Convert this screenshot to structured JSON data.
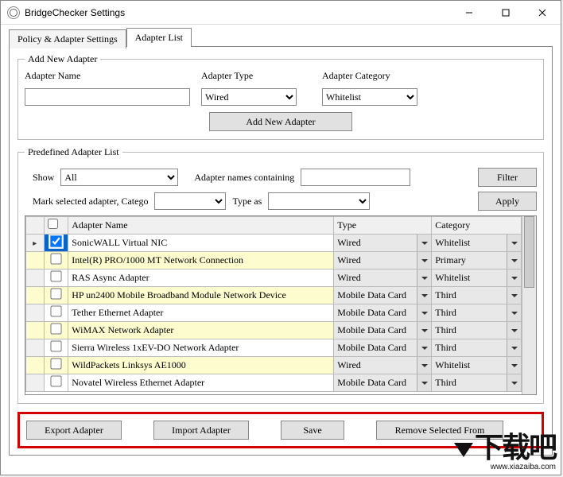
{
  "window": {
    "title": "BridgeChecker Settings"
  },
  "tabs": {
    "policy": "Policy & Adapter Settings",
    "list": "Adapter List"
  },
  "add": {
    "legend": "Add New Adapter",
    "name_label": "Adapter Name",
    "type_label": "Adapter Type",
    "category_label": "Adapter Category",
    "type_value": "Wired",
    "category_value": "Whitelist",
    "button": "Add New Adapter"
  },
  "predef": {
    "legend": "Predefined Adapter List",
    "show_label": "Show",
    "show_value": "All",
    "contains_label": "Adapter names containing",
    "filter_btn": "Filter",
    "mark_label": "Mark selected adapter, Catego",
    "typeas_label": "Type as",
    "apply_btn": "Apply"
  },
  "grid": {
    "headers": {
      "name": "Adapter Name",
      "type": "Type",
      "category": "Category"
    },
    "rows": [
      {
        "checked": true,
        "hl": false,
        "marker": true,
        "name": "SonicWALL Virtual NIC",
        "type": "Wired",
        "category": "Whitelist"
      },
      {
        "checked": false,
        "hl": true,
        "marker": false,
        "name": "Intel(R) PRO/1000 MT Network Connection",
        "type": "Wired",
        "category": "Primary"
      },
      {
        "checked": false,
        "hl": false,
        "marker": false,
        "name": "RAS Async Adapter",
        "type": "Wired",
        "category": "Whitelist"
      },
      {
        "checked": false,
        "hl": true,
        "marker": false,
        "name": "HP un2400 Mobile Broadband Module Network Device",
        "type": "Mobile Data Card",
        "category": "Third"
      },
      {
        "checked": false,
        "hl": false,
        "marker": false,
        "name": "Tether Ethernet Adapter",
        "type": "Mobile Data Card",
        "category": "Third"
      },
      {
        "checked": false,
        "hl": true,
        "marker": false,
        "name": "WiMAX Network Adapter",
        "type": "Mobile Data Card",
        "category": "Third"
      },
      {
        "checked": false,
        "hl": false,
        "marker": false,
        "name": "Sierra Wireless 1xEV-DO Network Adapter",
        "type": "Mobile Data Card",
        "category": "Third"
      },
      {
        "checked": false,
        "hl": true,
        "marker": false,
        "name": "WildPackets Linksys AE1000",
        "type": "Wired",
        "category": "Whitelist"
      },
      {
        "checked": false,
        "hl": false,
        "marker": false,
        "name": "Novatel Wireless Ethernet Adapter",
        "type": "Mobile Data Card",
        "category": "Third"
      }
    ]
  },
  "bottom": {
    "export": "Export Adapter",
    "import": "Import Adapter",
    "save": "Save",
    "remove": "Remove Selected From"
  },
  "watermark": {
    "text": "下载吧",
    "url": "www.xiazaiba.com"
  }
}
